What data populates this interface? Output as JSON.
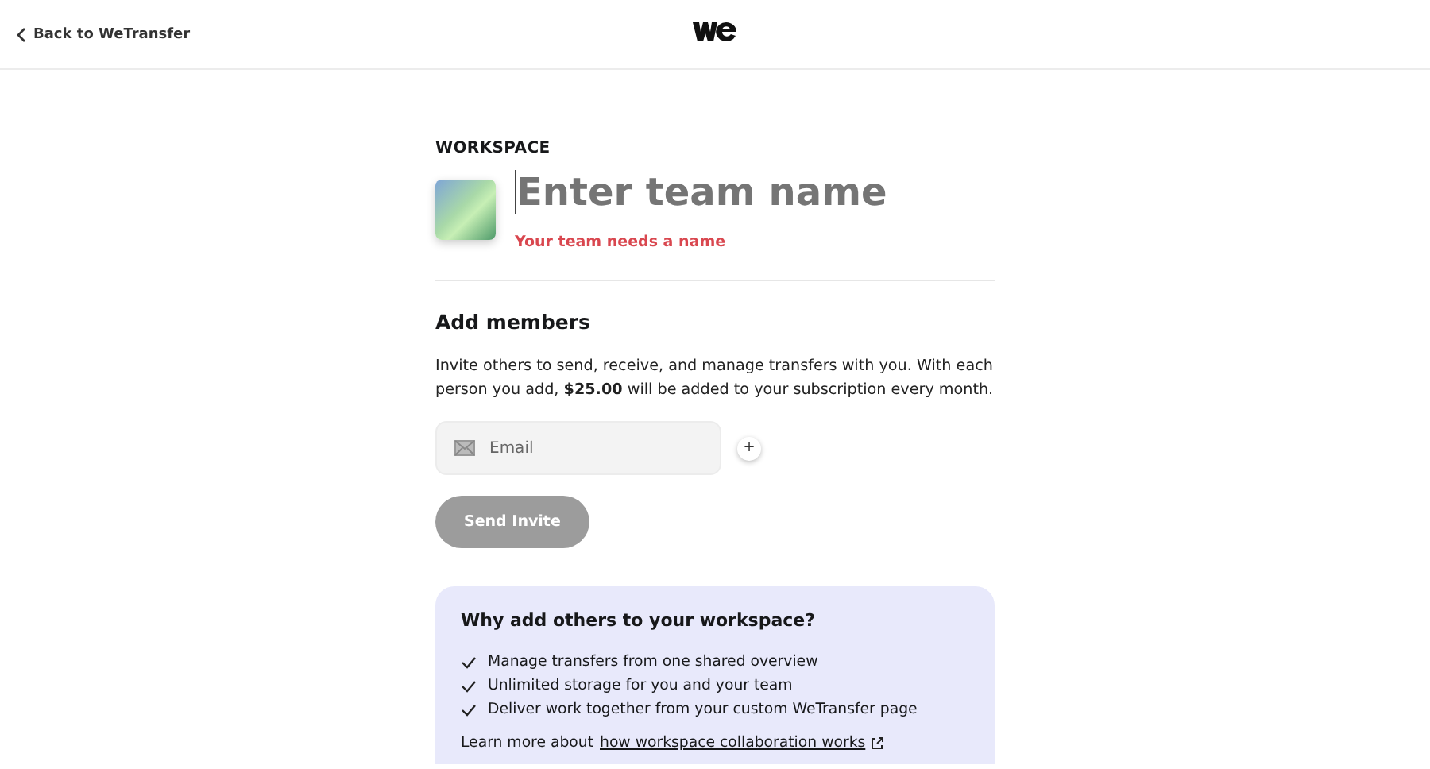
{
  "header": {
    "back_link": "Back to WeTransfer"
  },
  "workspace": {
    "label": "WORKSPACE",
    "name_placeholder": "Enter team name",
    "error": "Your team needs a name"
  },
  "members": {
    "title": "Add members",
    "description": "Invite others to send, receive, and manage transfers with you. With each person you add, **$25.00** will be added to your subscription every month.",
    "email_placeholder": "Email",
    "add_button": "+",
    "send_button": "Send Invite",
    "send_disabled": true
  },
  "benefits": {
    "title": "Why add others to your workspace?",
    "items": [
      "Manage transfers from one shared overview",
      "Unlimited storage for you and your team",
      "Deliver work together from your custom WeTransfer page"
    ],
    "learn_more": "Learn more about",
    "link": "how workspace collaboration works"
  }
}
